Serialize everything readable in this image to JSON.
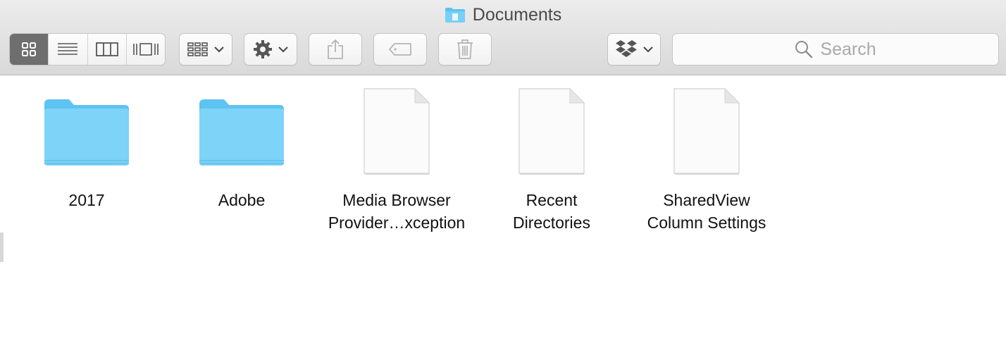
{
  "window": {
    "title": "Documents",
    "title_icon": "documents-folder-icon"
  },
  "toolbar": {
    "view_modes": [
      {
        "name": "icon-view",
        "icon": "grid-icon",
        "active": true
      },
      {
        "name": "list-view",
        "icon": "list-icon",
        "active": false
      },
      {
        "name": "column-view",
        "icon": "columns-icon",
        "active": false
      },
      {
        "name": "cover-flow-view",
        "icon": "cover-flow-icon",
        "active": false
      }
    ],
    "arrange_icon": "arrange-grid-icon",
    "action_icon": "gear-icon",
    "share_icon": "share-icon",
    "tag_icon": "tag-icon",
    "trash_icon": "trash-icon",
    "dropbox_icon": "dropbox-icon"
  },
  "search": {
    "placeholder": "Search"
  },
  "files": [
    {
      "type": "folder",
      "label_lines": [
        "2017"
      ]
    },
    {
      "type": "folder",
      "label_lines": [
        "Adobe"
      ]
    },
    {
      "type": "document",
      "label_lines": [
        "Media Browser",
        "Provider…xception"
      ]
    },
    {
      "type": "document",
      "label_lines": [
        "Recent",
        "Directories"
      ]
    },
    {
      "type": "document",
      "label_lines": [
        "SharedView",
        "Column Settings"
      ]
    }
  ],
  "colors": {
    "folder": "#6fcdf6",
    "active_segment": "#6e6e6e"
  }
}
